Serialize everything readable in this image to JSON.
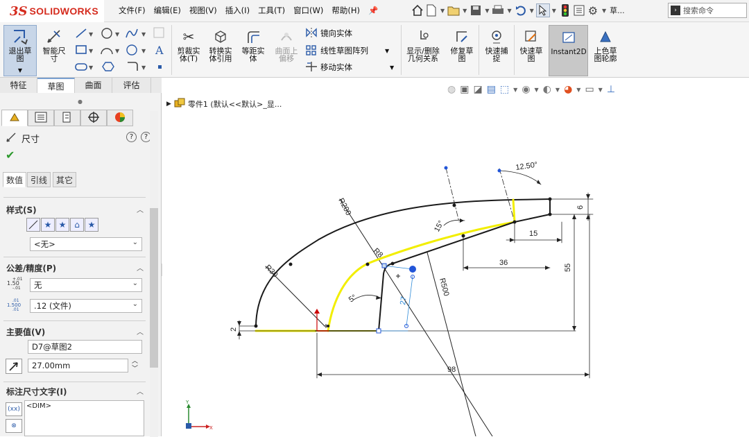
{
  "app": {
    "brand_ds": "3S",
    "brand_name": "SOLIDWORKS"
  },
  "menu": [
    "文件(F)",
    "编辑(E)",
    "视图(V)",
    "插入(I)",
    "工具(T)",
    "窗口(W)",
    "帮助(H)"
  ],
  "quick_access": {
    "more_label": "草...",
    "search_placeholder": "搜索命令"
  },
  "ribbon": {
    "exit_sketch": "退出草\n图",
    "smart_dim": "智能尺\n寸",
    "trim": "剪裁实\n体(T)",
    "convert": "转换实\n体引用",
    "offset": "等距实\n体",
    "surface_offset": "曲面上\n偏移",
    "mirror": "镜向实体",
    "linear_pattern": "线性草图阵列",
    "move": "移动实体",
    "display_relations": "显示/删除\n几何关系",
    "repair": "修复草\n图",
    "quick_snap": "快速捕\n捉",
    "rapid_sketch": "快速草\n图",
    "instant2d": "Instant2D",
    "shaded": "上色草\n图轮廓"
  },
  "cm_tabs": [
    "特征",
    "草图",
    "曲面",
    "评估"
  ],
  "cm_active": "草图",
  "property": {
    "title": "尺寸",
    "subtabs": [
      "数值",
      "引线",
      "其它"
    ],
    "style_label": "样式(S)",
    "style_value": "<无>",
    "tolerance_label": "公差/精度(P)",
    "tolerance_value": "无",
    "precision_value": ".12 (文件)",
    "primary_label": "主要值(V)",
    "primary_name": "D7@草图2",
    "primary_value": "27.00mm",
    "dimtext_label": "标注尺寸文字(I)",
    "dimtext_value": "<DIM>",
    "tol_sample_1": "1.50",
    "tol_sample_2": "1.500"
  },
  "tree": {
    "label": "零件1  (默认<<默认>_显..."
  },
  "dims": {
    "r200": "R200",
    "r30": "R30",
    "r8": "R8",
    "r500": "R500",
    "a12": "12.50°",
    "a15": "15°",
    "a5": "5°",
    "d6": "6",
    "d15": "15",
    "d36": "36",
    "d55": "55",
    "d27": "27",
    "d2": "2",
    "d98": "98"
  },
  "colors": {
    "accent": "#3a66b0",
    "sketch_yellow": "#f2ee00",
    "sketch_black": "#1a1a1a",
    "sketch_blue": "#2255d8",
    "green_check": "#2e9a2e"
  }
}
